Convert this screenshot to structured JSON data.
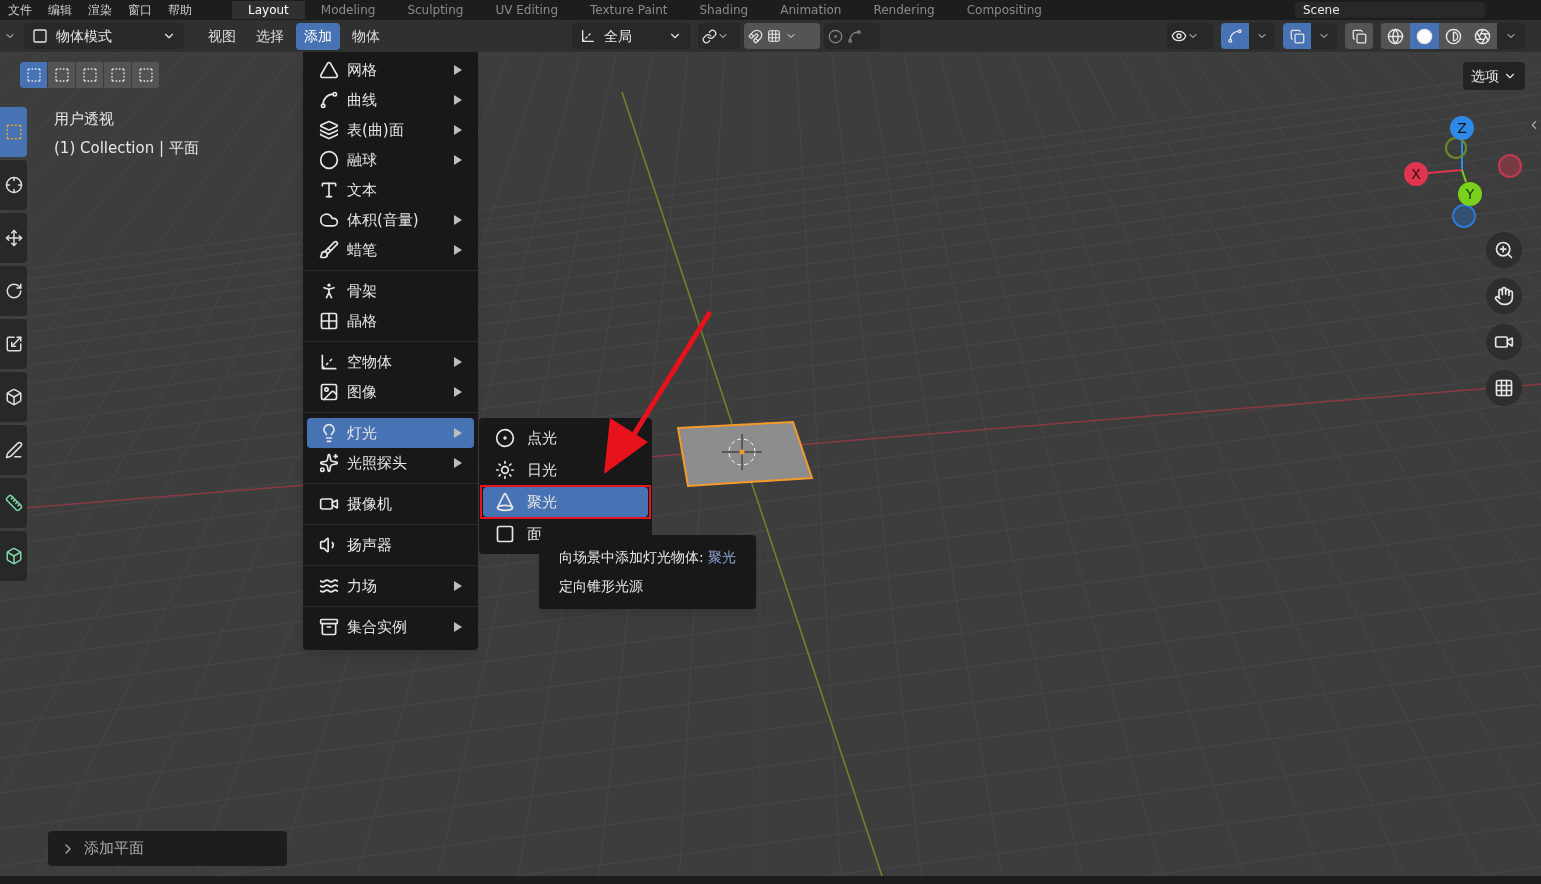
{
  "top_menu": [
    "文件",
    "编辑",
    "渲染",
    "窗口",
    "帮助"
  ],
  "workspace_tabs": [
    {
      "label": "Layout",
      "selected": true
    },
    {
      "label": "Modeling",
      "selected": false
    },
    {
      "label": "Sculpting",
      "selected": false
    },
    {
      "label": "UV Editing",
      "selected": false
    },
    {
      "label": "Texture Paint",
      "selected": false
    },
    {
      "label": "Shading",
      "selected": false
    },
    {
      "label": "Animation",
      "selected": false
    },
    {
      "label": "Rendering",
      "selected": false
    },
    {
      "label": "Compositing",
      "selected": false
    }
  ],
  "scene": "Scene",
  "header": {
    "mode": "物体模式",
    "menus": [
      {
        "label": "视图",
        "selected": false
      },
      {
        "label": "选择",
        "selected": false
      },
      {
        "label": "添加",
        "selected": true
      },
      {
        "label": "物体",
        "selected": false
      }
    ],
    "orientation": "全局",
    "snap": {
      "on": false
    },
    "proportional": {
      "on": false
    },
    "toggles": [
      {
        "on": true
      },
      {
        "on": true
      }
    ],
    "xray": {
      "on": false
    },
    "shading_modes": [
      {
        "selected": false
      },
      {
        "selected": true
      },
      {
        "selected": false
      },
      {
        "selected": false
      }
    ]
  },
  "select_modes": [
    {
      "selected": true
    },
    {
      "selected": false
    },
    {
      "selected": false
    },
    {
      "selected": false
    },
    {
      "selected": false
    }
  ],
  "tools": [
    {
      "selected": true
    },
    {
      "selected": false
    },
    {
      "selected": false
    },
    {
      "selected": false
    },
    {
      "selected": false
    },
    {
      "selected": false
    },
    {
      "selected": false
    },
    {
      "selected": false
    },
    {
      "selected": false
    }
  ],
  "viewport": {
    "view_name": "用户透视",
    "object_info": "(1) Collection | 平面",
    "options": "选项",
    "gizmo": [
      "Z",
      "X",
      "Y"
    ]
  },
  "add_menu": [
    [
      {
        "label": "网格",
        "submenu": true,
        "selected": false
      },
      {
        "label": "曲线",
        "submenu": true,
        "selected": false
      },
      {
        "label": "表(曲)面",
        "submenu": true,
        "selected": false
      },
      {
        "label": "融球",
        "submenu": true,
        "selected": false
      },
      {
        "label": "文本",
        "submenu": false,
        "selected": false
      },
      {
        "label": "体积(音量)",
        "submenu": true,
        "selected": false
      },
      {
        "label": "蜡笔",
        "submenu": true,
        "selected": false
      }
    ],
    [
      {
        "label": "骨架",
        "submenu": false,
        "selected": false
      },
      {
        "label": "晶格",
        "submenu": false,
        "selected": false
      }
    ],
    [
      {
        "label": "空物体",
        "submenu": true,
        "selected": false
      },
      {
        "label": "图像",
        "submenu": true,
        "selected": false
      }
    ],
    [
      {
        "label": "灯光",
        "submenu": true,
        "selected": true
      },
      {
        "label": "光照探头",
        "submenu": true,
        "selected": false
      }
    ],
    [
      {
        "label": "摄像机",
        "submenu": false,
        "selected": false
      }
    ],
    [
      {
        "label": "扬声器",
        "submenu": false,
        "selected": false
      }
    ],
    [
      {
        "label": "力场",
        "submenu": true,
        "selected": false
      }
    ],
    [
      {
        "label": "集合实例",
        "submenu": true,
        "selected": false
      }
    ]
  ],
  "light_submenu": [
    {
      "label": "点光",
      "selected": false
    },
    {
      "label": "日光",
      "selected": false
    },
    {
      "label": "聚光",
      "selected": true
    },
    {
      "label": "面",
      "selected": false
    }
  ],
  "tooltip": {
    "prefix": "向场景中添加灯光物体:",
    "target": "聚光",
    "description": "定向锥形光源"
  },
  "last_operator": "添加平面"
}
